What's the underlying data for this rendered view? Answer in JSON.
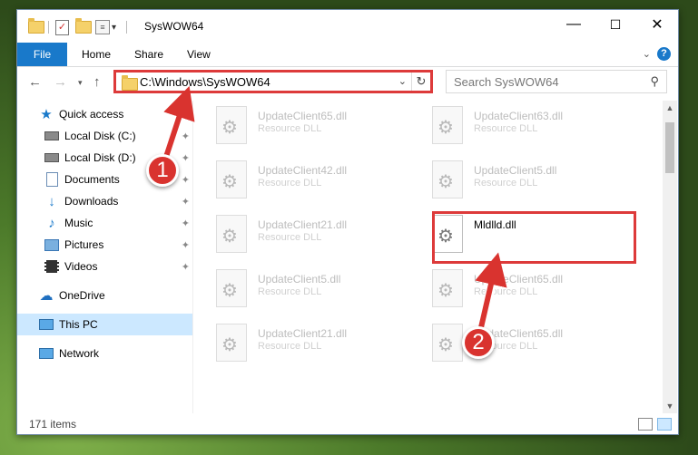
{
  "window": {
    "title": "SysWOW64",
    "controls": {
      "minimize": "—",
      "maximize": "☐",
      "close": "✕"
    }
  },
  "ribbon": {
    "tabs": [
      {
        "label": "File"
      },
      {
        "label": "Home"
      },
      {
        "label": "Share"
      },
      {
        "label": "View"
      }
    ]
  },
  "nav": {
    "address": "C:\\Windows\\SysWOW64",
    "search_placeholder": "Search SysWOW64"
  },
  "sidebar": {
    "items": [
      {
        "label": "Quick access",
        "icon": "star-icon"
      },
      {
        "label": "Local Disk (C:)",
        "icon": "drive-icon",
        "pinned": true
      },
      {
        "label": "Local Disk (D:)",
        "icon": "drive-icon",
        "pinned": true
      },
      {
        "label": "Documents",
        "icon": "documents-icon",
        "pinned": true
      },
      {
        "label": "Downloads",
        "icon": "download-icon",
        "pinned": true
      },
      {
        "label": "Music",
        "icon": "music-icon",
        "pinned": true
      },
      {
        "label": "Pictures",
        "icon": "pictures-icon",
        "pinned": true
      },
      {
        "label": "Videos",
        "icon": "videos-icon",
        "pinned": true
      },
      {
        "label": "OneDrive",
        "icon": "cloud-icon"
      },
      {
        "label": "This PC",
        "icon": "computer-icon",
        "selected": true
      },
      {
        "label": "Network",
        "icon": "network-icon"
      }
    ]
  },
  "files": [
    {
      "name": "UpdateClient65.dll",
      "type": "Resource DLL"
    },
    {
      "name": "UpdateClient63.dll",
      "type": "Resource DLL"
    },
    {
      "name": "UpdateClient42.dll",
      "type": "Resource DLL"
    },
    {
      "name": "UpdateClient5.dll",
      "type": "Resource DLL"
    },
    {
      "name": "UpdateClient21.dll",
      "type": "Resource DLL"
    },
    {
      "name": "Mldlld.dll",
      "type": "",
      "highlighted": true
    },
    {
      "name": "UpdateClient5.dll",
      "type": "Resource DLL"
    },
    {
      "name": "UpdateClient65.dll",
      "type": "Resource DLL"
    },
    {
      "name": "UpdateClient21.dll",
      "type": "Resource DLL"
    },
    {
      "name": "UpdateClient65.dll",
      "type": "Resource DLL"
    }
  ],
  "status": {
    "item_count": "171 items"
  },
  "callouts": [
    {
      "label": "1"
    },
    {
      "label": "2"
    }
  ],
  "colors": {
    "accent": "#1979ca",
    "highlight": "#dd3a3a",
    "selection": "#cce8ff"
  }
}
